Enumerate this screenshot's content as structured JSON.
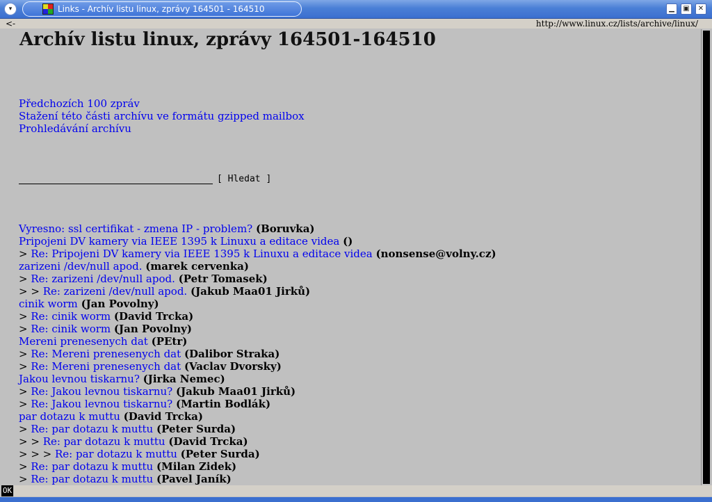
{
  "window": {
    "title": "Links - Archív listu linux, zprávy 164501 - 164510",
    "menu_glyph": "▾",
    "minimize_glyph": "▁",
    "maximize_glyph": "▣",
    "close_glyph": "✕"
  },
  "urlbar": {
    "back": "<-",
    "url": "http://www.linux.cz/lists/archive/linux/"
  },
  "page": {
    "title": "Archív listu linux, zprávy 164501-164510",
    "links": [
      "Předchozích 100 zpráv",
      "Stažení této části archívu ve formátu gzipped mailbox",
      "Prohledávání archívu"
    ],
    "search": {
      "value": "",
      "button": "[ Hledat ]"
    }
  },
  "messages": [
    {
      "prefix": "",
      "subject": "Vyresno: ssl certifikat - zmena IP - problem?",
      "author": "(Boruvka)"
    },
    {
      "prefix": "",
      "subject": "Pripojeni DV kamery via IEEE 1395 k Linuxu a editace videa",
      "author": "()"
    },
    {
      "prefix": "> ",
      "subject": "Re: Pripojeni DV kamery via IEEE 1395 k Linuxu a editace videa",
      "author": "(nonsense@volny.cz)"
    },
    {
      "prefix": "",
      "subject": "zarizeni /dev/null apod.",
      "author": "(marek cervenka)"
    },
    {
      "prefix": "> ",
      "subject": "Re: zarizeni /dev/null apod.",
      "author": "(Petr Tomasek)"
    },
    {
      "prefix": "> > ",
      "subject": "Re: zarizeni /dev/null apod.",
      "author": "(Jakub Maa01 Jirků)"
    },
    {
      "prefix": "",
      "subject": "cinik worm",
      "author": "(Jan Povolny)"
    },
    {
      "prefix": "> ",
      "subject": "Re: cinik worm",
      "author": "(David Trcka)"
    },
    {
      "prefix": "> ",
      "subject": "Re: cinik worm",
      "author": "(Jan Povolny)"
    },
    {
      "prefix": "",
      "subject": "Mereni prenesenych dat",
      "author": "(PEtr)"
    },
    {
      "prefix": "> ",
      "subject": "Re: Mereni prenesenych dat",
      "author": "(Dalibor Straka)"
    },
    {
      "prefix": "> ",
      "subject": "Re: Mereni prenesenych dat",
      "author": "(Vaclav Dvorsky)"
    },
    {
      "prefix": "",
      "subject": "Jakou levnou tiskarnu?",
      "author": "(Jirka Nemec)"
    },
    {
      "prefix": "> ",
      "subject": "Re: Jakou levnou tiskarnu?",
      "author": "(Jakub Maa01 Jirků)"
    },
    {
      "prefix": "> ",
      "subject": "Re: Jakou levnou tiskarnu?",
      "author": "(Martin Bodlák)"
    },
    {
      "prefix": "",
      "subject": "par dotazu k muttu",
      "author": "(David Trcka)"
    },
    {
      "prefix": "> ",
      "subject": "Re: par dotazu k muttu",
      "author": "(Peter Surda)"
    },
    {
      "prefix": "> > ",
      "subject": "Re: par dotazu k muttu",
      "author": "(David Trcka)"
    },
    {
      "prefix": "> > > ",
      "subject": "Re: par dotazu k muttu",
      "author": "(Peter Surda)"
    },
    {
      "prefix": "> ",
      "subject": "Re: par dotazu k muttu",
      "author": "(Milan Zidek)"
    },
    {
      "prefix": "> ",
      "subject": "Re: par dotazu k muttu",
      "author": "(Pavel Janík)"
    }
  ],
  "status": {
    "ok": "OK"
  }
}
